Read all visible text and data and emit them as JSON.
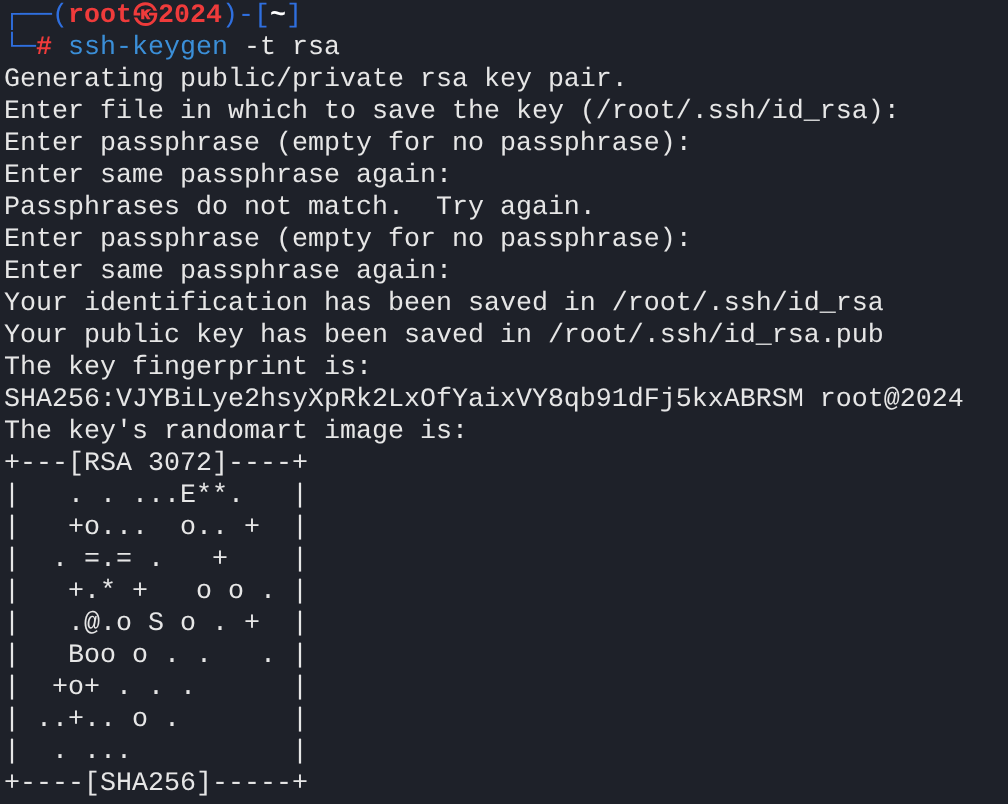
{
  "prompt": {
    "segments": [
      {
        "kind": "frame",
        "text": "┌──("
      },
      {
        "kind": "user",
        "text": "root㉿2024"
      },
      {
        "kind": "frame",
        "text": ")-["
      },
      {
        "kind": "path",
        "text": "~"
      },
      {
        "kind": "frame",
        "text": "]"
      }
    ],
    "corner": "└─",
    "symbol": "#",
    "program": "ssh-keygen",
    "args": "-t rsa"
  },
  "output": [
    "Generating public/private rsa key pair.",
    "Enter file in which to save the key (/root/.ssh/id_rsa):",
    "Enter passphrase (empty for no passphrase):",
    "Enter same passphrase again:",
    "Passphrases do not match.  Try again.",
    "Enter passphrase (empty for no passphrase):",
    "Enter same passphrase again:",
    "Your identification has been saved in /root/.ssh/id_rsa",
    "Your public key has been saved in /root/.ssh/id_rsa.pub",
    "The key fingerprint is:",
    "SHA256:VJYBiLye2hsyXpRk2LxOfYaixVY8qb91dFj5kxABRSM root@2024",
    "The key's randomart image is:"
  ],
  "randomart": [
    "+---[RSA 3072]----+",
    "|   . . ...E**.   |",
    "|   +o...  o.. +  |",
    "|  . =.= .   +    |",
    "|   +.* +   o o . |",
    "|   .@.o S o . +  |",
    "|   Boo o . .   . |",
    "|  +o+ . . .      |",
    "| ..+.. o .       |",
    "|  . ...          |",
    "+----[SHA256]-----+"
  ]
}
